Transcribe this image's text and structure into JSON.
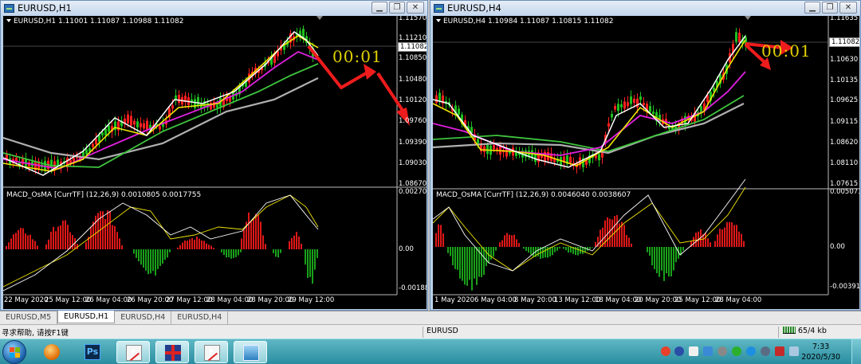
{
  "windows": [
    {
      "id": "w1",
      "title": "EURUSD,H1",
      "chart_header": "EURUSD,H1  1.11001 1.11087 1.10988 1.11082",
      "indicator_header": "MACD_OsMA [CurrTF] (12,26,9) 0.0010805 0.0017755",
      "price_labels": [
        "1.11570",
        "1.11210",
        "1.10850",
        "1.10480",
        "1.10120",
        "1.09760",
        "1.09390",
        "1.09030",
        "1.08670"
      ],
      "current_price": "1.11082",
      "indicator_labels": [
        "0.0027057",
        "0.00",
        "-0.001884"
      ],
      "time_labels": [
        "22 May 2020",
        "25 May 12:00",
        "26 May 04:00",
        "26 May 20:00",
        "27 May 12:00",
        "28 May 04:00",
        "28 May 20:00",
        "29 May 12:00"
      ],
      "timer": "00:01"
    },
    {
      "id": "w2",
      "title": "EURUSD,H4",
      "chart_header": "EURUSD,H4  1.10984 1.11087 1.10815 1.11082",
      "indicator_header": "MACD_OsMA [CurrTF] (12,26,9) 0.0046040 0.0038607",
      "price_labels": [
        "1.11635",
        "1.11082",
        "1.10630",
        "1.10135",
        "1.09625",
        "1.09115",
        "1.08620",
        "1.08110",
        "1.07615"
      ],
      "current_price": "1.11082",
      "indicator_labels": [
        "0.0050736",
        "0.00",
        "-0.003913"
      ],
      "time_labels": [
        "1 May 2020",
        "6 May 04:00",
        "8 May 20:00",
        "13 May 12:00",
        "18 May 04:00",
        "20 May 20:00",
        "25 May 12:00",
        "28 May 04:00"
      ],
      "timer": "00:01"
    }
  ],
  "tabs": [
    "EURUSD,M5",
    "EURUSD,H1",
    "EURUSD,H4",
    "EURUSD,H4"
  ],
  "active_tab": 1,
  "status": {
    "help": "寻求帮助, 请按F1键",
    "symbol": "EURUSD",
    "traffic": "65/4 kb"
  },
  "taskbar": {
    "time": "7:33",
    "date": "2020/5/30"
  },
  "colors": {
    "bull_candle": "#ff2020",
    "bear_candle": "#1fbf1f",
    "ma_fast": "#ffffff",
    "ma_yellow": "#f2e600",
    "ma_magenta": "#e020e0",
    "ma_green": "#3ec43e",
    "ma_gray": "#b0b0b0",
    "hist_up": "#e01818",
    "hist_down": "#1aa01a",
    "timer": "#e0d000",
    "arrow": "#ee1c1c"
  }
}
